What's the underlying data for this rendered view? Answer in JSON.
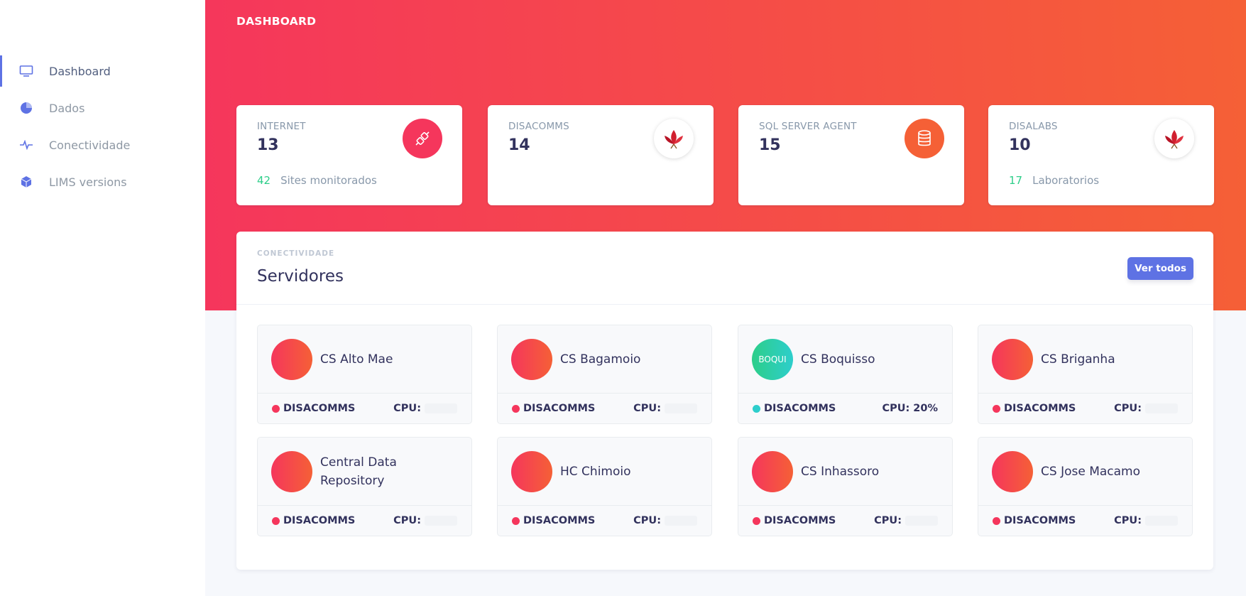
{
  "sidebar": {
    "items": [
      {
        "label": "Dashboard",
        "icon": "monitor-icon"
      },
      {
        "label": "Dados",
        "icon": "pie-chart-icon"
      },
      {
        "label": "Conectividade",
        "icon": "activity-icon"
      },
      {
        "label": "LIMS versions",
        "icon": "cube-icon"
      }
    ]
  },
  "header": {
    "title": "DASHBOARD"
  },
  "stats": [
    {
      "title": "INTERNET",
      "value": "13",
      "icon": "plug-icon",
      "foot_num": "42",
      "foot_label": "Sites monitorados"
    },
    {
      "title": "DISACOMMS",
      "value": "14",
      "icon": "flower-logo-icon"
    },
    {
      "title": "SQL SERVER AGENT",
      "value": "15",
      "icon": "database-icon"
    },
    {
      "title": "DISALABS",
      "value": "10",
      "icon": "flower-logo-icon",
      "foot_num": "17",
      "foot_label": "Laboratorios"
    }
  ],
  "servers_card": {
    "overline": "CONECTIVIDADE",
    "title": "Servidores",
    "button": "Ver todos",
    "servers": [
      {
        "name": "CS Alto Mae",
        "service": "DISACOMMS",
        "cpu_label": "CPU:",
        "cpu": "",
        "status": "offline"
      },
      {
        "name": "CS Bagamoio",
        "service": "DISACOMMS",
        "cpu_label": "CPU:",
        "cpu": "",
        "status": "offline"
      },
      {
        "name": "CS Boquisso",
        "avatar_text": "BOQUI",
        "service": "DISACOMMS",
        "cpu_label": "CPU:",
        "cpu": "20%",
        "status": "online"
      },
      {
        "name": "CS Briganha",
        "service": "DISACOMMS",
        "cpu_label": "CPU:",
        "cpu": "",
        "status": "offline"
      },
      {
        "name": "Central Data Repository",
        "service": "DISACOMMS",
        "cpu_label": "CPU:",
        "cpu": "",
        "status": "offline"
      },
      {
        "name": "HC Chimoio",
        "service": "DISACOMMS",
        "cpu_label": "CPU:",
        "cpu": "",
        "status": "offline"
      },
      {
        "name": "CS Inhassoro",
        "service": "DISACOMMS",
        "cpu_label": "CPU:",
        "cpu": "",
        "status": "offline"
      },
      {
        "name": "CS Jose Macamo",
        "service": "DISACOMMS",
        "cpu_label": "CPU:",
        "cpu": "",
        "status": "offline"
      }
    ]
  },
  "colors": {
    "gradient_start": "#f5365c",
    "gradient_end": "#f56036",
    "primary": "#5e72e4",
    "success": "#2dce89"
  }
}
